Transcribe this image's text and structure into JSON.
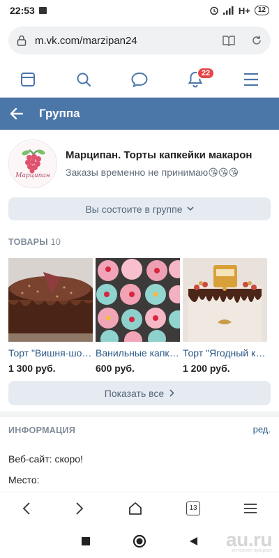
{
  "status_bar": {
    "time": "22:53",
    "network": "H+",
    "battery": "12"
  },
  "browser": {
    "url": "m.vk.com/marzipan24",
    "tab_count": "13"
  },
  "vk_nav": {
    "notifications_badge": "22"
  },
  "header": {
    "title": "Группа"
  },
  "group": {
    "name": "Марципан. Торты капкейки макарон",
    "status": "Заказы временно не принимаю😘😘😘",
    "logo_text": "Марципан",
    "member_button": "Вы состоите в группе"
  },
  "products": {
    "title": "ТОВАРЫ",
    "count": "10",
    "items": [
      {
        "name": "Торт \"Вишня-шоколад\"",
        "price": "1 300 руб."
      },
      {
        "name": "Ванильные капкейки",
        "price": "600 руб."
      },
      {
        "name": "Торт \"Ягодный каприз\"",
        "price": "1 200 руб."
      }
    ],
    "show_all": "Показать все"
  },
  "info": {
    "title": "ИНФОРМАЦИЯ",
    "edit": "ред.",
    "website_label": "Веб-сайт:",
    "website_value": "скоро!",
    "place_label": "Место:"
  },
  "watermark": {
    "brand": "au.ru",
    "tagline": "интернет-аукцион"
  },
  "colors": {
    "vk_blue": "#4a76a8",
    "link": "#2a5885",
    "badge_red": "#e64646",
    "button_bg": "#e5ebf1"
  }
}
